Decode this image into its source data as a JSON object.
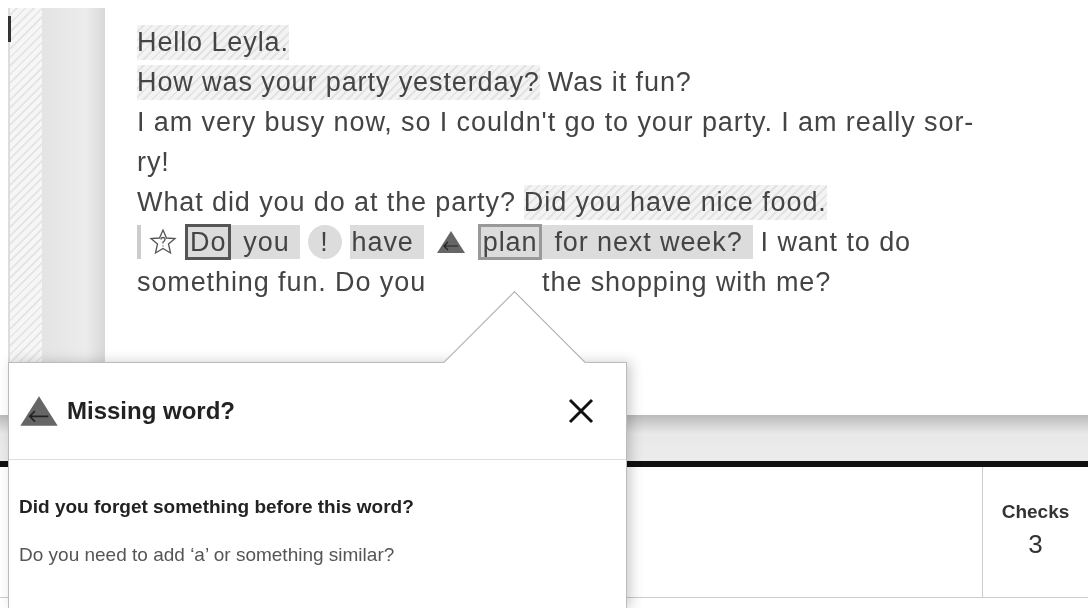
{
  "document": {
    "lines": [
      {
        "segments": [
          {
            "kind": "hatched",
            "text": "Hello Leyla."
          }
        ]
      },
      {
        "segments": [
          {
            "kind": "hatched",
            "text": "How was your party yesterday?"
          },
          {
            "kind": "plain",
            "text": "Was it fun?"
          }
        ]
      },
      {
        "segments": [
          {
            "kind": "plain",
            "text": "I am very busy now, so I couldn't go to your party. I am really sor-"
          }
        ]
      },
      {
        "segments": [
          {
            "kind": "plain",
            "text": "ry!"
          }
        ]
      },
      {
        "segments": [
          {
            "kind": "plain",
            "text": "What did you do at the party?"
          },
          {
            "kind": "hatched",
            "text": "Did you have nice food."
          }
        ]
      },
      {
        "segments": [
          {
            "kind": "margin-bar"
          },
          {
            "kind": "star"
          },
          {
            "kind": "group",
            "words": [
              {
                "text": "Do",
                "kind": "strong"
              },
              {
                "text": "you"
              }
            ]
          },
          {
            "kind": "alert",
            "text": "!"
          },
          {
            "kind": "group",
            "words": [
              {
                "text": "have"
              }
            ]
          },
          {
            "kind": "missing"
          },
          {
            "kind": "group",
            "words": [
              {
                "text": "plan",
                "kind": "light"
              },
              {
                "text": "for next week?"
              }
            ]
          },
          {
            "kind": "plain",
            "text": "I want to do"
          }
        ]
      },
      {
        "segments": [
          {
            "kind": "plain",
            "text": "something fun. Do you"
          },
          {
            "kind": "gap"
          },
          {
            "kind": "plain",
            "text": "the shopping with me?"
          }
        ]
      }
    ]
  },
  "popup": {
    "title": "Missing word?",
    "question": "Did you forget something before this word?",
    "hint": "Do you need to add ‘a’ or something similar?"
  },
  "stats": [
    {
      "label": "Checks",
      "value": "3"
    }
  ]
}
